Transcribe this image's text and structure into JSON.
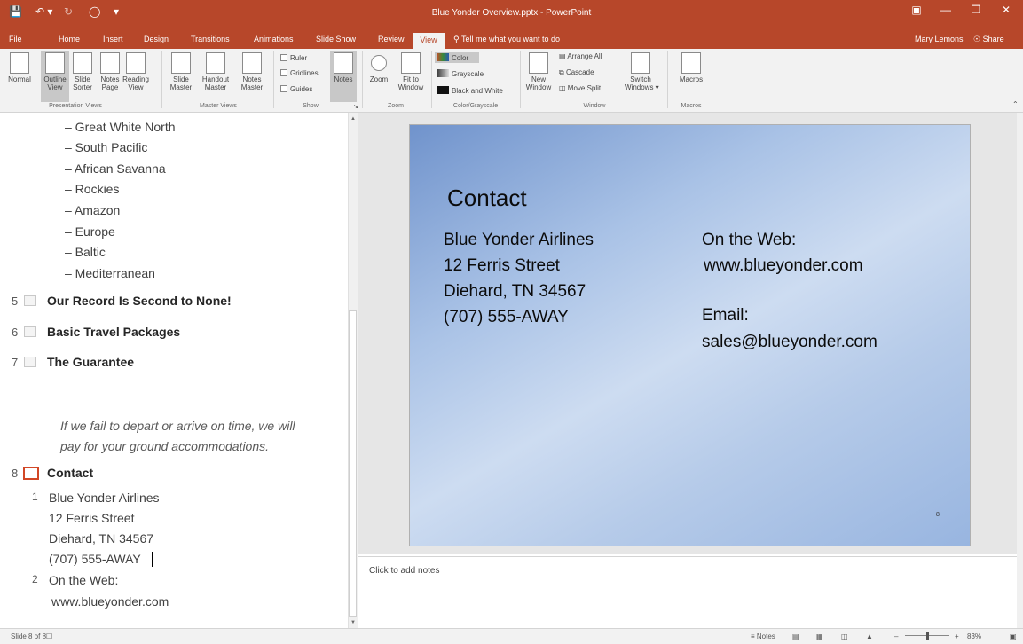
{
  "window": {
    "title": "Blue Yonder Overview.pptx - PowerPoint",
    "user": "Mary Lemons",
    "share": "Share"
  },
  "tabs": [
    "File",
    "Home",
    "Insert",
    "Design",
    "Transitions",
    "Animations",
    "Slide Show",
    "Review",
    "View"
  ],
  "active_tab": "View",
  "tell_me": "Tell me what you want to do",
  "ribbon": {
    "presentation_views": {
      "normal": "Normal",
      "outline": "Outline View",
      "outline_1": "Outline",
      "outline_2": "View",
      "sorter_1": "Slide",
      "sorter_2": "Sorter",
      "notes_1": "Notes",
      "notes_2": "Page",
      "reading_1": "Reading",
      "reading_2": "View",
      "label": "Presentation Views"
    },
    "master_views": {
      "slide_1": "Slide",
      "slide_2": "Master",
      "handout_1": "Handout",
      "handout_2": "Master",
      "notes_1": "Notes",
      "notes_2": "Master",
      "label": "Master Views"
    },
    "show": {
      "ruler": "Ruler",
      "gridlines": "Gridlines",
      "guides": "Guides",
      "notes": "Notes",
      "label": "Show"
    },
    "zoom": {
      "zoom": "Zoom",
      "fit_1": "Fit to",
      "fit_2": "Window",
      "label": "Zoom"
    },
    "color": {
      "color": "Color",
      "grayscale": "Grayscale",
      "bw": "Black and White",
      "label": "Color/Grayscale"
    },
    "window": {
      "new_1": "New",
      "new_2": "Window",
      "arrange": "Arrange All",
      "cascade": "Cascade",
      "move_split": "Move Split",
      "switch_1": "Switch",
      "switch_2": "Windows",
      "label": "Window"
    },
    "macros": {
      "macros": "Macros",
      "label": "Macros"
    }
  },
  "outline": {
    "sub_items": [
      "– Great White North",
      "– South Pacific",
      "– African Savanna",
      "– Rockies",
      "– Amazon",
      "– Europe",
      "– Baltic",
      "– Mediterranean"
    ],
    "slides": [
      {
        "num": "5",
        "title": "Our Record Is Second to None!"
      },
      {
        "num": "6",
        "title": "Basic Travel Packages"
      },
      {
        "num": "7",
        "title": "The Guarantee"
      }
    ],
    "guarantee_text_1": "If we fail to depart or arrive on time, we will",
    "guarantee_text_2": "pay for your ground accommodations.",
    "current": {
      "num": "8",
      "title": "Contact"
    },
    "contact_lines": [
      "Blue Yonder Airlines",
      "12 Ferris Street",
      "Diehard, TN 34567",
      "(707) 555-AWAY"
    ],
    "web_num": "2",
    "web_lines": [
      "On the Web:",
      "www.blueyonder.com"
    ],
    "addr_num": "1"
  },
  "slide": {
    "title": "Contact",
    "left": [
      "Blue Yonder Airlines",
      "12 Ferris Street",
      "Diehard, TN 34567",
      "(707) 555-AWAY"
    ],
    "right": [
      "On the Web:",
      "www.blueyonder.com",
      "Email:",
      "sales@blueyonder.com"
    ],
    "number": "8"
  },
  "notes_placeholder": "Click to add notes",
  "status": {
    "slide_info": "Slide 8 of 8",
    "notes": "Notes",
    "zoom": "83%"
  },
  "colors": {
    "accent": "#b7472a"
  }
}
